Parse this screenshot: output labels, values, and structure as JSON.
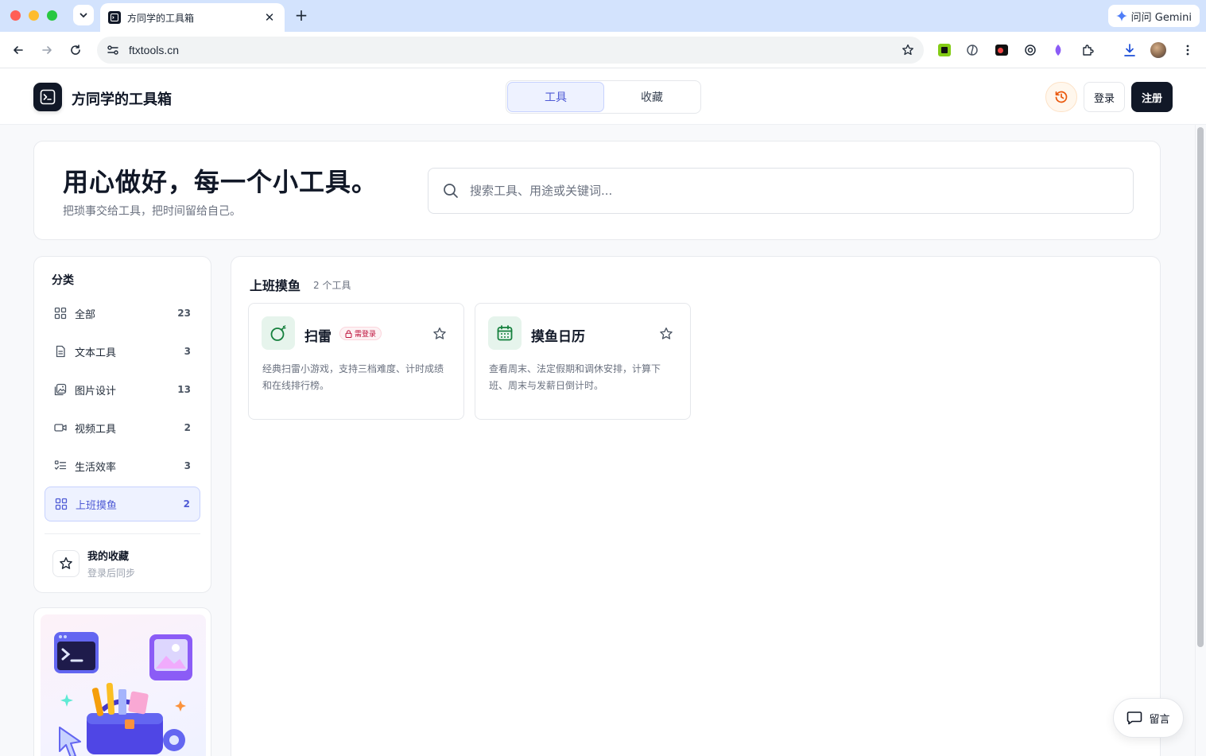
{
  "browser": {
    "tab_title": "方同学的工具箱",
    "url": "ftxtools.cn",
    "gemini_label": "问问 Gemini",
    "new_tab_symbol": "+",
    "close_symbol": "✕"
  },
  "header": {
    "site_title": "方同学的工具箱",
    "tabs": [
      {
        "label": "工具",
        "active": true
      },
      {
        "label": "收藏",
        "active": false
      }
    ],
    "login_label": "登录",
    "register_label": "注册"
  },
  "hero": {
    "title": "用心做好，每一个小工具。",
    "subtitle": "把琐事交给工具，把时间留给自己。",
    "search_placeholder": "搜索工具、用途或关键词..."
  },
  "sidebar": {
    "heading": "分类",
    "items": [
      {
        "label": "全部",
        "count": "23",
        "icon": "grid-icon",
        "active": false
      },
      {
        "label": "文本工具",
        "count": "3",
        "icon": "document-icon",
        "active": false
      },
      {
        "label": "图片设计",
        "count": "13",
        "icon": "image-icon",
        "active": false
      },
      {
        "label": "视频工具",
        "count": "2",
        "icon": "video-icon",
        "active": false
      },
      {
        "label": "生活效率",
        "count": "3",
        "icon": "checklist-icon",
        "active": false
      },
      {
        "label": "上班摸鱼",
        "count": "2",
        "icon": "grid-icon",
        "active": true
      }
    ],
    "favorites_title": "我的收藏",
    "favorites_sub": "登录后同步"
  },
  "content": {
    "section_title": "上班摸鱼",
    "section_count": "2 个工具",
    "cards": [
      {
        "title": "扫雷",
        "badge": "需登录",
        "icon": "bomb-icon",
        "description": "经典扫雷小游戏，支持三档难度、计时成绩和在线排行榜。"
      },
      {
        "title": "摸鱼日历",
        "badge": "",
        "icon": "calendar-icon",
        "description": "查看周末、法定假期和调休安排，计算下班、周末与发薪日倒计时。"
      }
    ]
  },
  "feedback_label": "留言",
  "colors": {
    "accent": "#4f5bd5",
    "accent_bg": "#eef2ff",
    "dark": "#111827",
    "icon_green": "#15803d",
    "badge_red": "#be123c",
    "history_orange": "#ea580c"
  }
}
